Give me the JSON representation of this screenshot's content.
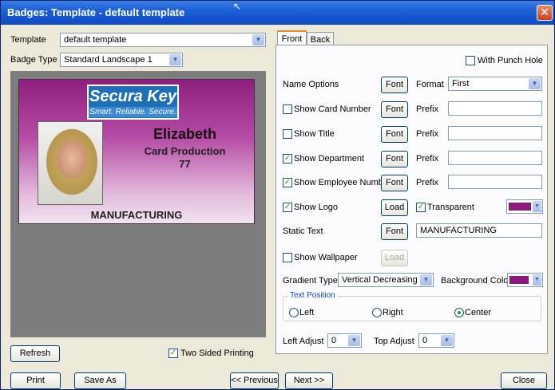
{
  "window": {
    "title": "Badges: Template - default template",
    "close_glyph": "✕"
  },
  "left": {
    "template_label": "Template",
    "template_value": "default template",
    "badge_type_label": "Badge Type",
    "badge_type_value": "Standard Landscape 1",
    "refresh_label": "Refresh",
    "two_sided_label": "Two Sided Printing",
    "two_sided_checked": true
  },
  "badge": {
    "logo_top": "Secura Key",
    "logo_bottom": "Smart. Reliable. Secure.",
    "name": "Elizabeth",
    "department": "Card Production",
    "employee_number": "77",
    "static_text": "MANUFACTURING",
    "gradient_color": "#8b1b7a"
  },
  "tabs": {
    "front": "Front",
    "back": "Back",
    "active": "front"
  },
  "front": {
    "punch_hole_label": "With Punch Hole",
    "punch_hole_checked": false,
    "name_options_label": "Name Options",
    "font_label": "Font",
    "load_label": "Load",
    "format_label": "Format",
    "format_value": "First",
    "prefix_label": "Prefix",
    "show_card_number_label": "Show Card Number",
    "show_card_number_checked": false,
    "show_title_label": "Show Title",
    "show_title_checked": false,
    "show_department_label": "Show Department",
    "show_department_checked": true,
    "show_employee_number_label": "Show Employee Number",
    "show_employee_number_checked": true,
    "show_logo_label": "Show Logo",
    "show_logo_checked": true,
    "transparent_label": "Transparent",
    "transparent_checked": true,
    "logo_color": "#8b1b7a",
    "static_text_label": "Static Text",
    "static_text_value": "MANUFACTURING",
    "show_wallpaper_label": "Show Wallpaper",
    "show_wallpaper_checked": false,
    "gradient_type_label": "Gradient Type",
    "gradient_type_value": "Vertical Decreasing",
    "background_color_label": "Background Color",
    "background_color": "#8b1b7a",
    "text_position_label": "Text Position",
    "pos_left": "Left",
    "pos_right": "Right",
    "pos_center": "Center",
    "pos_selected": "Center",
    "left_adjust_label": "Left Adjust",
    "left_adjust_value": "0",
    "top_adjust_label": "Top Adjust",
    "top_adjust_value": "0"
  },
  "footer": {
    "print": "Print",
    "save_as": "Save As",
    "previous": "<< Previous",
    "next": "Next >>",
    "close": "Close"
  }
}
